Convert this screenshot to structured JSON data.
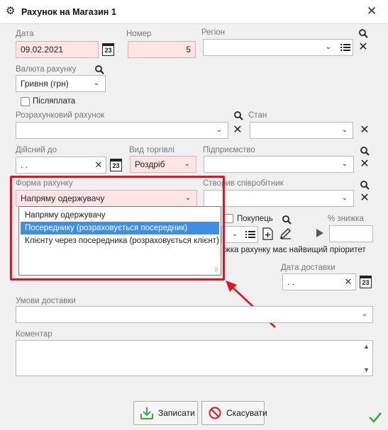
{
  "window": {
    "title": "Рахунок на Магазин 1"
  },
  "fields": {
    "date": {
      "label": "Дата",
      "value": "09.02.2021"
    },
    "number": {
      "label": "Номер",
      "value": "5"
    },
    "region": {
      "label": "Регіон",
      "value": ""
    },
    "currency": {
      "label": "Валюта рахунку",
      "value": "Гривня (грн)"
    },
    "postpay": {
      "label": "Післяплата",
      "checked": false
    },
    "settlement_account": {
      "label": "Розрахунковий рахунок",
      "value": ""
    },
    "state": {
      "label": "Стан",
      "value": ""
    },
    "valid_until": {
      "label": "Дійсний до",
      "value": " .  ."
    },
    "trade_type": {
      "label": "Вид торгівлі",
      "value": "Роздріб"
    },
    "enterprise": {
      "label": "Підприємство",
      "value": ""
    },
    "payment_form": {
      "label": "Форма рахунку",
      "value": "Напряму одержувачу",
      "options": [
        "Напряму одержувачу",
        "Посереднику (розраховується посередник)",
        "Клієнту через посередника (розраховується клієнт)"
      ],
      "highlighted_index": 1
    },
    "creator": {
      "label": "Створив співробітник",
      "value": ""
    },
    "buyer": {
      "label": "Покупець",
      "checked": false
    },
    "discount": {
      "label": "% знижка",
      "value": ""
    },
    "discount_note": "жка рахунку має найвищий пріоритет",
    "delivery_date": {
      "label": "Дата доставки",
      "value": " .  ."
    },
    "delivery_terms": {
      "label": "Умови доставки",
      "value": ""
    },
    "comment": {
      "label": "Коментар",
      "value": ""
    }
  },
  "buttons": {
    "save": "Записати",
    "cancel": "Скасувати"
  },
  "icons": {
    "calendar_text": "23"
  },
  "colors": {
    "required_bg": "#ffe4e6",
    "highlight": "#3e8ee6",
    "annotation_red": "#e3141e",
    "ok_green": "#3aa84a"
  }
}
